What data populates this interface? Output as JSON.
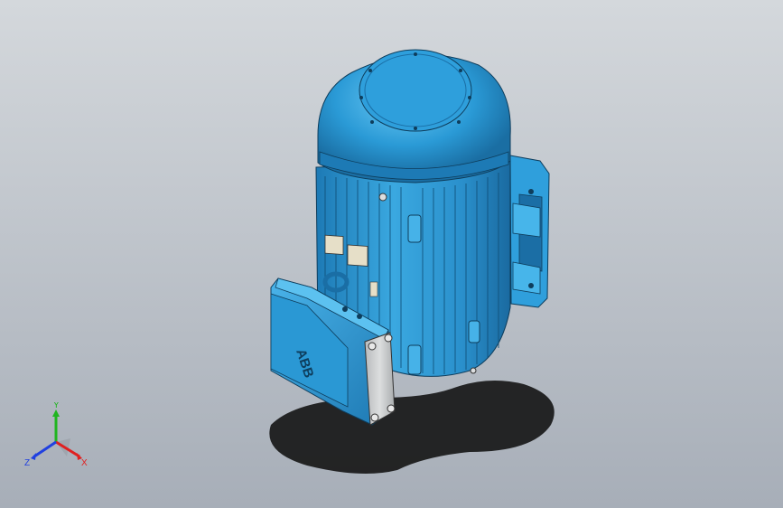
{
  "viewport": {
    "background_top": "#d4d8dc",
    "background_bottom": "#a7aeb8"
  },
  "model": {
    "body_color": "#2a9ad6",
    "highlight_color": "#5cc1f0",
    "shadow_color": "#1b6da0",
    "terminal_box_cover_color": "#c9cbcc",
    "logo_text": "ABB"
  },
  "triad": {
    "y_label": "Y",
    "x_label": "X",
    "z_label": "Z",
    "y_color": "#1fb51f",
    "x_color": "#e02020",
    "z_color": "#2040e0"
  }
}
